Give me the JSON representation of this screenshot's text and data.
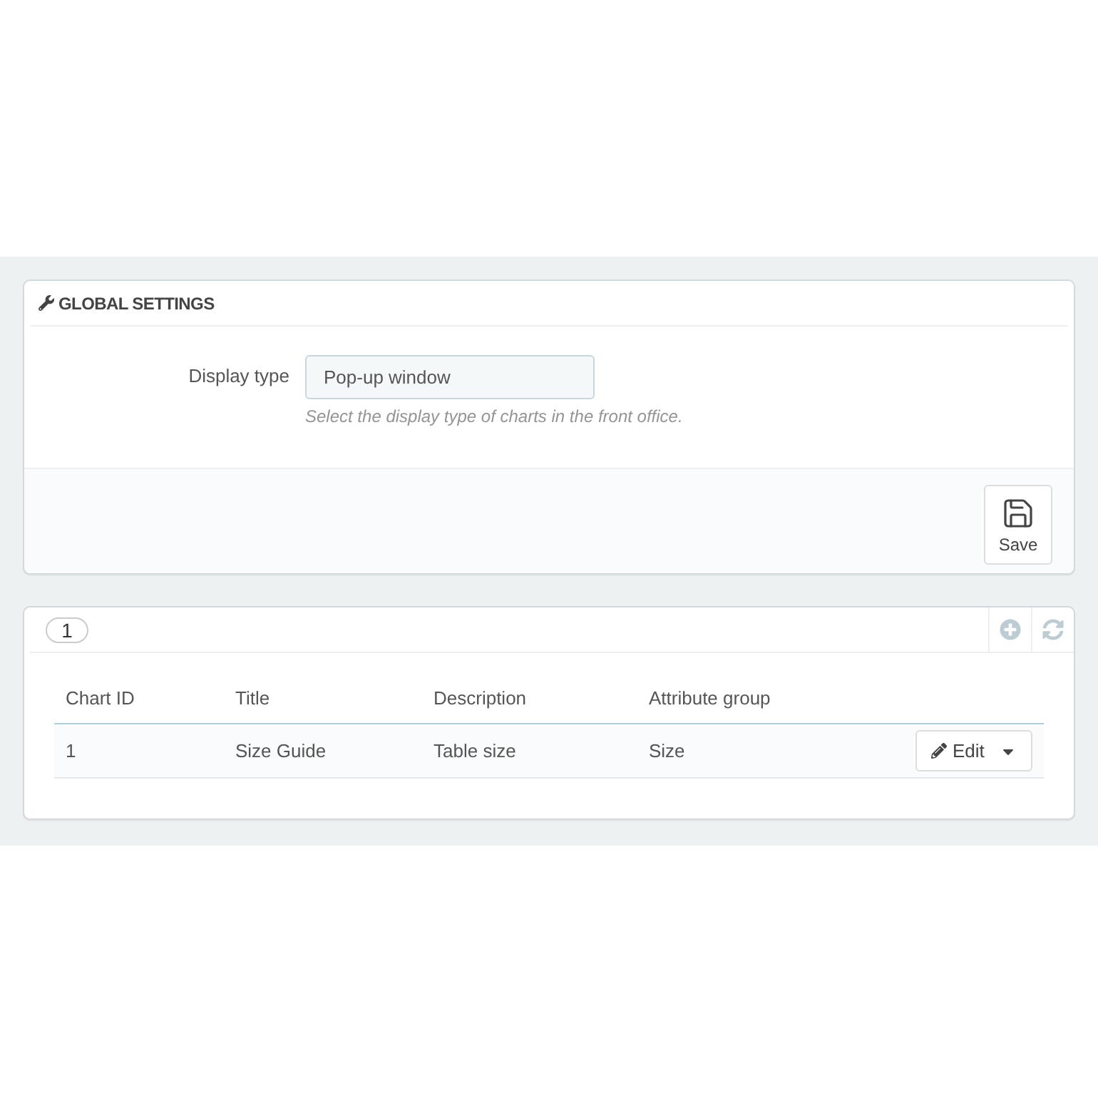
{
  "global_settings": {
    "title": "GLOBAL SETTINGS",
    "fields": [
      {
        "label": "Display type",
        "value": "Pop-up window",
        "help": "Select the display type of charts in the front office."
      }
    ],
    "save_button": "Save"
  },
  "charts_list": {
    "count": "1",
    "columns": [
      "Chart ID",
      "Title",
      "Description",
      "Attribute group"
    ],
    "rows": [
      {
        "cells": [
          "1",
          "Size Guide",
          "Table size",
          "Size"
        ],
        "action": "Edit"
      }
    ]
  }
}
